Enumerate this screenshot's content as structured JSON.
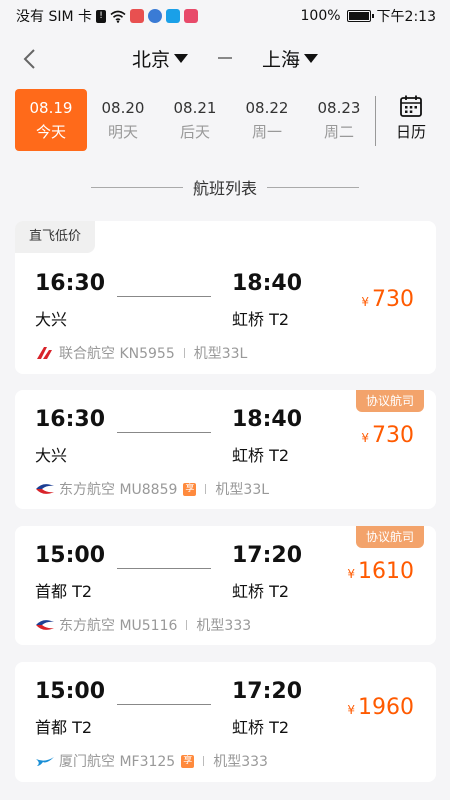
{
  "status_bar": {
    "carrier": "没有 SIM 卡",
    "battery": "100%",
    "time": "下午2:13"
  },
  "header": {
    "from_city": "北京",
    "to_city": "上海"
  },
  "dates": [
    {
      "date": "08.19",
      "weekday": "今天",
      "active": true
    },
    {
      "date": "08.20",
      "weekday": "明天",
      "active": false
    },
    {
      "date": "08.21",
      "weekday": "后天",
      "active": false
    },
    {
      "date": "08.22",
      "weekday": "周一",
      "active": false
    },
    {
      "date": "08.23",
      "weekday": "周二",
      "active": false
    }
  ],
  "calendar_label": "日历",
  "section_title": "航班列表",
  "flights": [
    {
      "tag": "直飞低价",
      "dep_time": "16:30",
      "dep_airport": "大兴",
      "arr_time": "18:40",
      "arr_airport": "虹桥 T2",
      "currency": "¥",
      "price": "730",
      "airline": "联合航空 KN5955",
      "shared": false,
      "aircraft": "机型33L",
      "logo": "china-united-logo-icon"
    },
    {
      "tag": "协议航司",
      "dep_time": "16:30",
      "dep_airport": "大兴",
      "arr_time": "18:40",
      "arr_airport": "虹桥 T2",
      "currency": "¥",
      "price": "730",
      "airline": "东方航空 MU8859",
      "shared": true,
      "shared_label": "享",
      "aircraft": "机型33L",
      "logo": "china-eastern-logo-icon"
    },
    {
      "tag": "协议航司",
      "dep_time": "15:00",
      "dep_airport": "首都 T2",
      "arr_time": "17:20",
      "arr_airport": "虹桥 T2",
      "currency": "¥",
      "price": "1610",
      "airline": "东方航空 MU5116",
      "shared": false,
      "aircraft": "机型333",
      "logo": "china-eastern-logo-icon"
    },
    {
      "tag": "",
      "dep_time": "15:00",
      "dep_airport": "首都 T2",
      "arr_time": "17:20",
      "arr_airport": "虹桥 T2",
      "currency": "¥",
      "price": "1960",
      "airline": "厦门航空 MF3125",
      "shared": true,
      "shared_label": "享",
      "aircraft": "机型333",
      "logo": "xiamen-airlines-logo-icon"
    }
  ],
  "colors": {
    "accent": "#ff6a1a",
    "price": "#ff5a00",
    "agree_tag": "#f3a36b"
  }
}
